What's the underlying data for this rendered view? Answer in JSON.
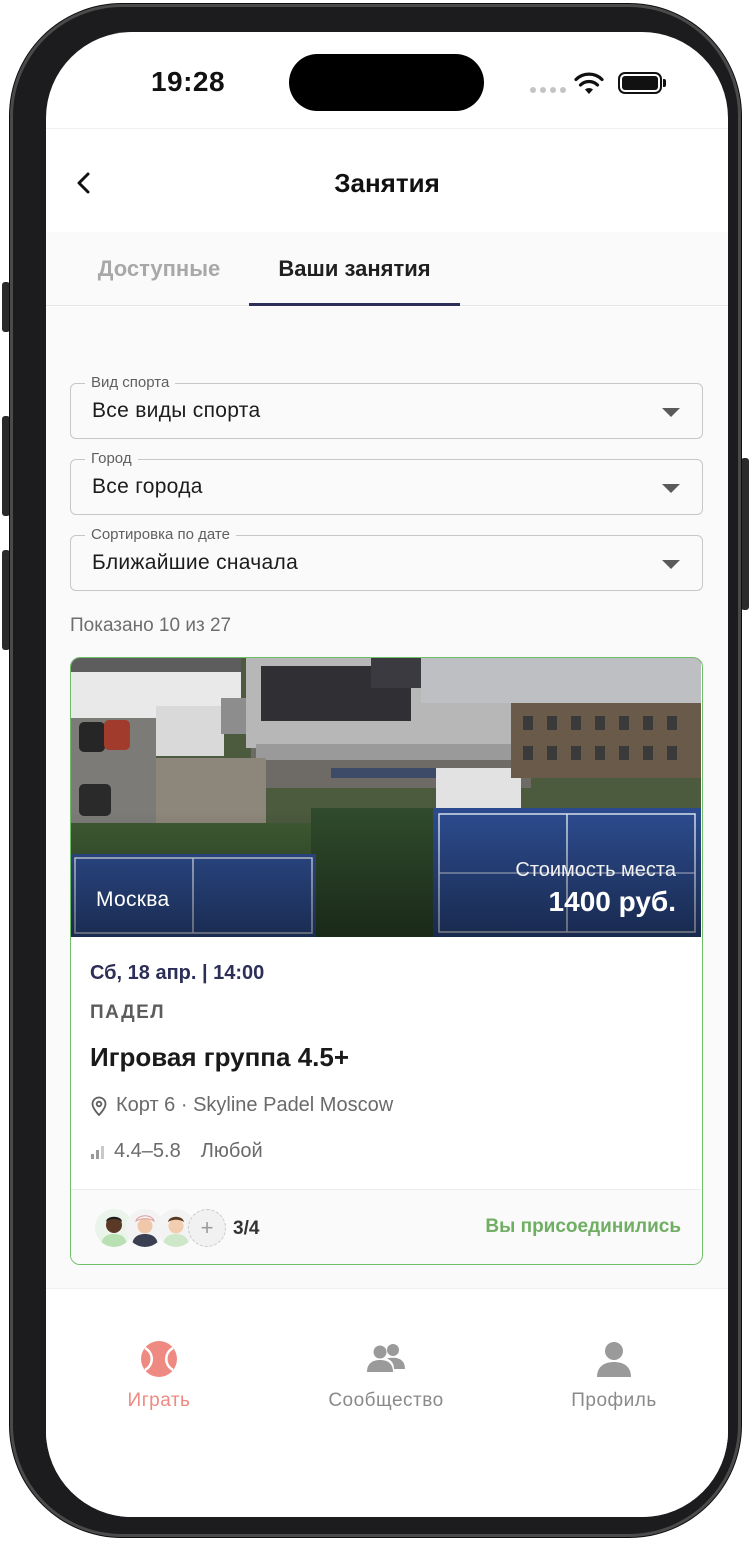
{
  "status_bar": {
    "time": "19:28"
  },
  "nav": {
    "title": "Занятия"
  },
  "tabs": [
    {
      "label": "Доступные",
      "active": false
    },
    {
      "label": "Ваши занятия",
      "active": true
    }
  ],
  "filters": {
    "sport": {
      "label": "Вид спорта",
      "value": "Все виды спорта"
    },
    "city": {
      "label": "Город",
      "value": "Все города"
    },
    "sort": {
      "label": "Сортировка по дате",
      "value": "Ближайшие сначала"
    }
  },
  "results_count": "Показано 10 из 27",
  "card": {
    "city": "Москва",
    "price_label": "Стоимость места",
    "price": "1400 руб.",
    "date": "Сб, 18 апр. | 14:00",
    "sport": "ПАДЕЛ",
    "title": "Игровая группа 4.5+",
    "location": "Корт 6 · Skyline Padel Moscow",
    "level": "4.4–5.8",
    "level_type": "Любой",
    "add_symbol": "+",
    "participants": "3/4",
    "status": "Вы присоединились"
  },
  "bottom_nav": [
    {
      "label": "Играть",
      "icon": "tennis-ball-icon",
      "active": true
    },
    {
      "label": "Сообщество",
      "icon": "group-icon",
      "active": false
    },
    {
      "label": "Профиль",
      "icon": "person-icon",
      "active": false
    }
  ],
  "colors": {
    "accent": "#2d2f59",
    "active_tab": "#ee8a82",
    "joined": "#6fae63",
    "card_border": "#6fbf6a"
  }
}
